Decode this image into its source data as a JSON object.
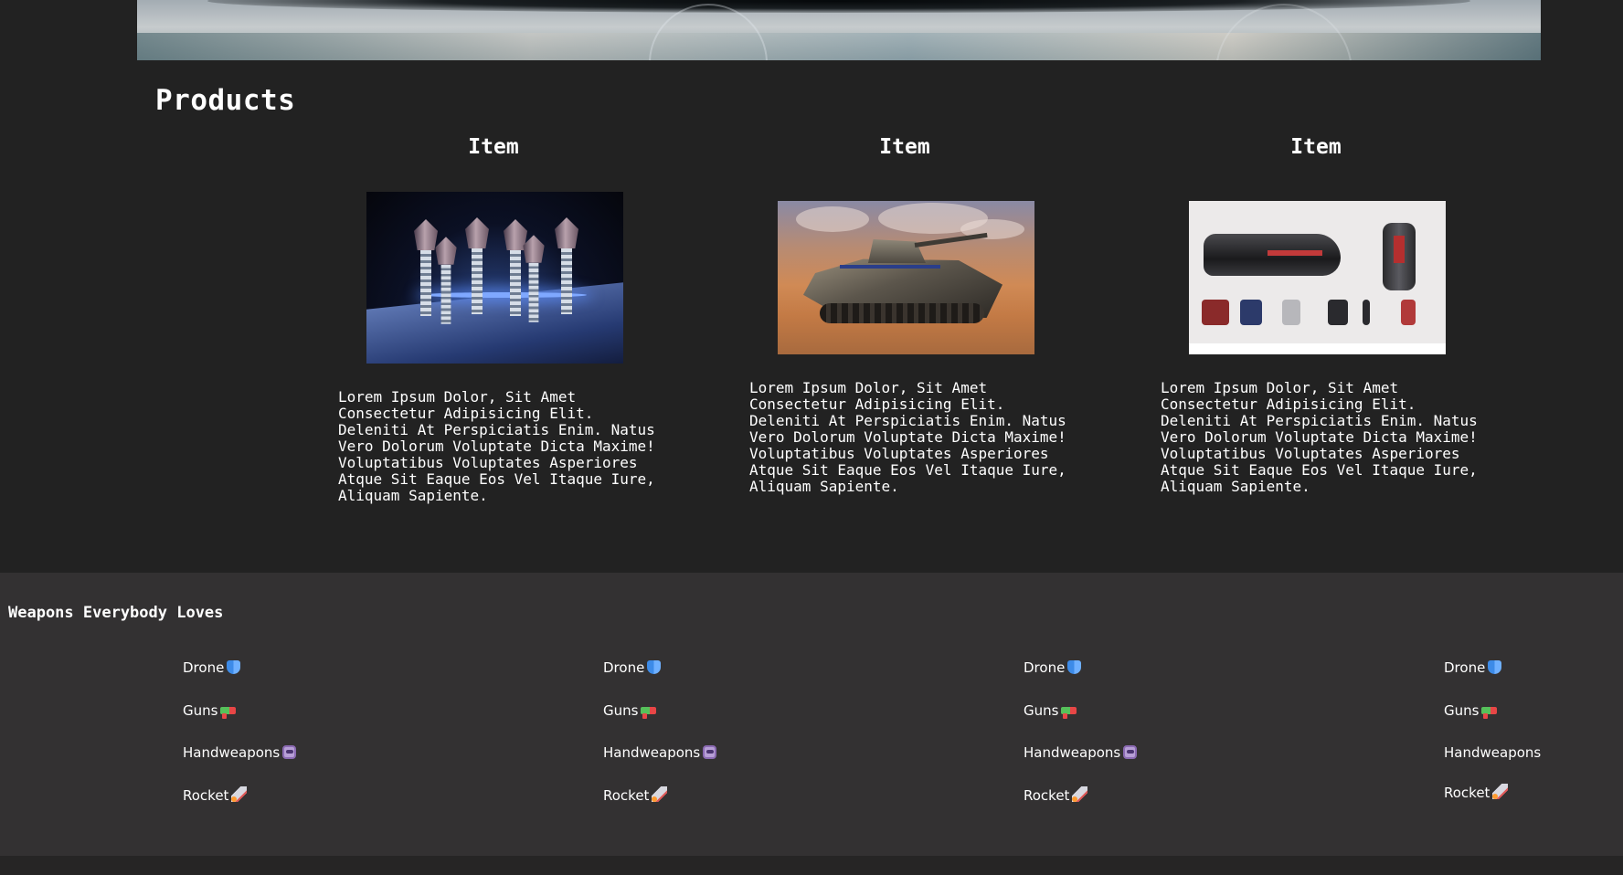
{
  "products": {
    "heading": "Products",
    "items": [
      {
        "title": "Item",
        "image": "metal-bolts-photo",
        "description": "Lorem Ipsum Dolor, Sit Amet\nConsectetur Adipisicing Elit.\nDeleniti At Perspiciatis Enim. Natus\nVero Dolorum Voluptate Dicta Maxime!\nVoluptatibus Voluptates Asperiores\nAtque Sit Eaque Eos Vel Itaque Iure,\nAliquam Sapiente."
      },
      {
        "title": "Item",
        "image": "tank-photo",
        "description": "Lorem Ipsum Dolor, Sit Amet\nConsectetur Adipisicing Elit.\nDeleniti At Perspiciatis Enim. Natus\nVero Dolorum Voluptate Dicta Maxime!\nVoluptatibus Voluptates Asperiores\nAtque Sit Eaque Eos Vel Itaque Iure,\nAliquam Sapiente."
      },
      {
        "title": "Item",
        "image": "weapon-gear-photo",
        "description": "Lorem Ipsum Dolor, Sit Amet\nConsectetur Adipisicing Elit.\nDeleniti At Perspiciatis Enim. Natus\nVero Dolorum Voluptate Dicta Maxime!\nVoluptatibus Voluptates Asperiores\nAtque Sit Eaque Eos Vel Itaque Iure,\nAliquam Sapiente."
      }
    ]
  },
  "footer": {
    "title": "Weapons Everybody Loves",
    "columns": [
      {
        "links": [
          {
            "label": "Drone",
            "icon": "shield-icon"
          },
          {
            "label": "Guns",
            "icon": "water-gun-icon"
          },
          {
            "label": "Handweapons",
            "icon": "robot-icon"
          },
          {
            "label": "Rocket",
            "icon": "rocket-icon"
          }
        ]
      },
      {
        "links": [
          {
            "label": "Drone",
            "icon": "shield-icon"
          },
          {
            "label": "Guns",
            "icon": "water-gun-icon"
          },
          {
            "label": "Handweapons",
            "icon": "robot-icon"
          },
          {
            "label": "Rocket",
            "icon": "rocket-icon"
          }
        ]
      },
      {
        "links": [
          {
            "label": "Drone",
            "icon": "shield-icon"
          },
          {
            "label": "Guns",
            "icon": "water-gun-icon"
          },
          {
            "label": "Handweapons",
            "icon": "robot-icon"
          },
          {
            "label": "Rocket",
            "icon": "rocket-icon"
          }
        ]
      },
      {
        "links": [
          {
            "label": "Drone",
            "icon": "shield-icon"
          },
          {
            "label": "Guns",
            "icon": "water-gun-icon"
          },
          {
            "label": "Handweapons",
            "icon": ""
          },
          {
            "label": "Rocket",
            "icon": "rocket-icon"
          }
        ]
      }
    ]
  },
  "colors": {
    "page_background": "#222222",
    "footer_background": "#333132",
    "text": "#ffffff"
  }
}
